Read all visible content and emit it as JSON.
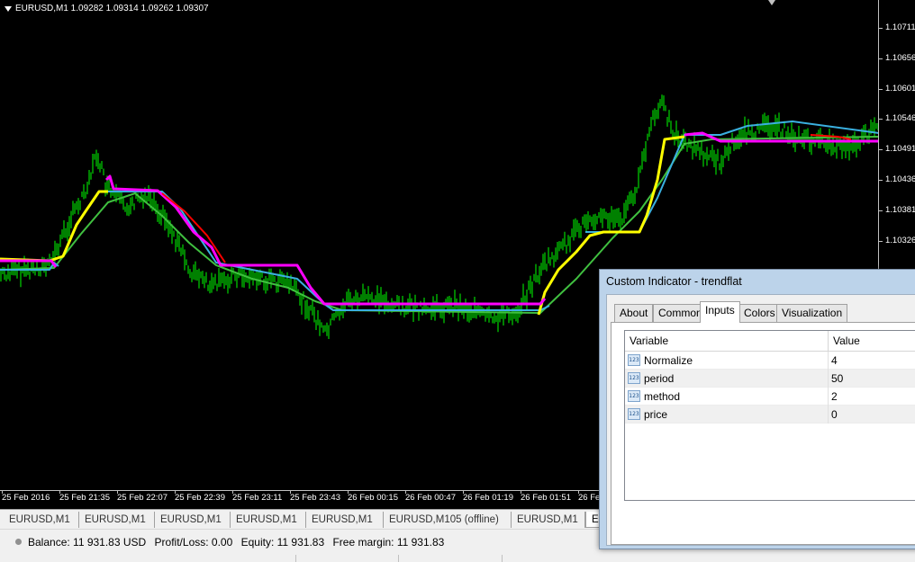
{
  "chart": {
    "header": "EURUSD,M1  1.09282 1.09314 1.09262 1.09307",
    "price_axis": [
      "1.10711",
      "1.10656",
      "1.10601",
      "1.10546",
      "1.10491",
      "1.10436",
      "1.10381",
      "1.10326"
    ],
    "time_axis": [
      "25 Feb 2016",
      "25 Feb 21:35",
      "25 Feb 22:07",
      "25 Feb 22:39",
      "25 Feb 23:11",
      "25 Feb 23:43",
      "26 Feb 00:15",
      "26 Feb 00:47",
      "26 Feb 01:19",
      "26 Feb 01:51",
      "26 Fe"
    ],
    "colors": {
      "background": "#000000",
      "price_series": "#00ff00",
      "ma_series": "#40c040",
      "trendflat_up": "#ffff00",
      "trendflat_down": "#ff00ff",
      "trendflat_flat": "#3ab0e0",
      "trendflat_alt": "#ff0000"
    }
  },
  "chart_tabs": [
    "EURUSD,M1",
    "EURUSD,M1",
    "EURUSD,M1",
    "EURUSD,M1",
    "EURUSD,M1",
    "EURUSD,M105 (offline)",
    "EURUSD,M1",
    "E"
  ],
  "status": {
    "balance": "Balance: 11 931.83 USD",
    "profit": "Profit/Loss: 0.00",
    "equity": "Equity: 11 931.83",
    "margin": "Free margin: 11 931.83"
  },
  "dialog": {
    "title": "Custom Indicator - trendflat",
    "tabs": [
      "About",
      "Common",
      "Inputs",
      "Colors",
      "Visualization"
    ],
    "active_tab": "Inputs",
    "grid": {
      "headers": [
        "Variable",
        "Value"
      ],
      "rows": [
        {
          "name": "Normalize",
          "value": "4",
          "icon": "123"
        },
        {
          "name": "period",
          "value": "50",
          "icon": "123"
        },
        {
          "name": "method",
          "value": "2",
          "icon": "123"
        },
        {
          "name": "price",
          "value": "0",
          "icon": "123"
        }
      ]
    }
  }
}
